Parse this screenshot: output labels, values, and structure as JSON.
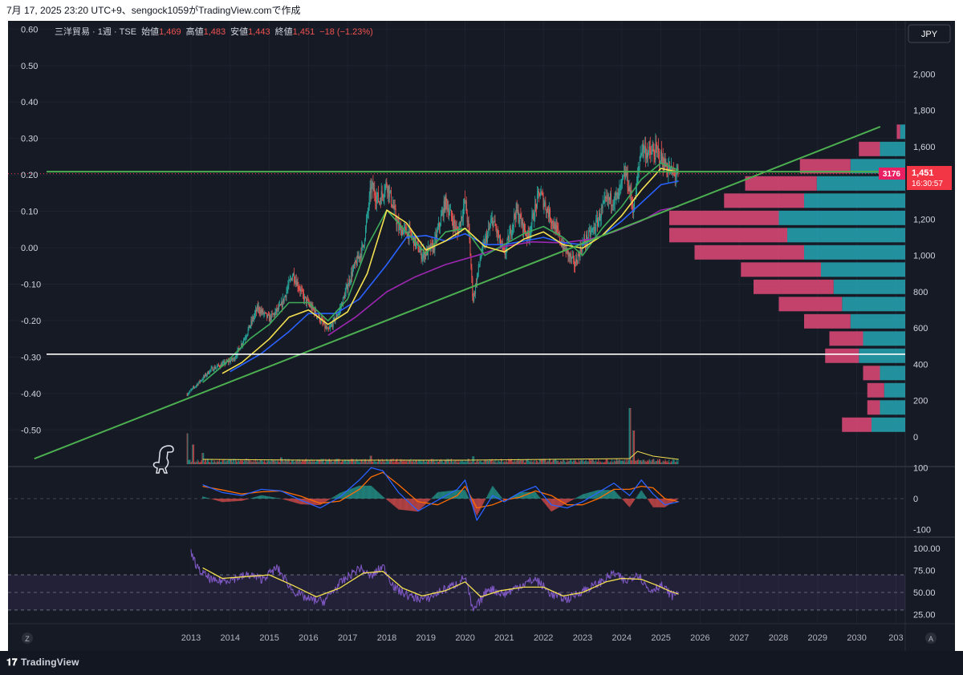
{
  "header": {
    "caption": "7月 17, 2025 23:20 UTC+9、sengock1059がTradingView.comで作成"
  },
  "legend": {
    "symbol": "三洋貿易 · 1週 · TSE",
    "open_label": "始値",
    "open": "1,469",
    "high_label": "高値",
    "high": "1,483",
    "low_label": "安値",
    "low": "1,443",
    "close_label": "終値",
    "close": "1,451",
    "change": "−18 (−1.23%)"
  },
  "currency": "JPY",
  "price_badge": {
    "value": "1,451",
    "countdown": "16:30:57"
  },
  "vp_badge": "3176",
  "pane_markers": {
    "left": "Z",
    "right": "A"
  },
  "footer": {
    "brand": "TradingView"
  },
  "colors": {
    "background": "#161a25",
    "up": "#26a69a",
    "down": "#ef5350",
    "ma_green": "#3dab5a",
    "ma_yellow": "#f5e150",
    "ma_blue": "#2962ff",
    "ma_purple": "#9c27b0",
    "trendline": "#4caf50",
    "resistance": "#4caf50",
    "support": "#ffffff",
    "vp_up": "#26a6b4",
    "vp_down": "#e04a78",
    "macd": "#2962ff",
    "signal": "#ff6d00",
    "rsi": "#7e57c2",
    "rsi_ma": "#f5e150"
  },
  "chart_data": [
    {
      "type": "candlestick",
      "pane": "price",
      "interval": "1W",
      "x_range": [
        2013,
        2030.6
      ],
      "y_range_right": [
        0,
        2150
      ],
      "y_range_left": [
        -0.6,
        0.62
      ],
      "right_ticks": [
        "0",
        "200",
        "400",
        "600",
        "800",
        "1,000",
        "1,200",
        "1,400",
        "1,600",
        "1,800",
        "2,000"
      ],
      "left_ticks": [
        "0.60",
        "0.50",
        "0.40",
        "0.30",
        "0.20",
        "0.10",
        "0.00",
        "-0.10",
        "-0.20",
        "-0.30",
        "-0.40",
        "-0.50"
      ],
      "x_ticks": [
        "2013",
        "2014",
        "2015",
        "2016",
        "2017",
        "2018",
        "2019",
        "2020",
        "2021",
        "2022",
        "2023",
        "2024",
        "2025",
        "2026",
        "2027",
        "2028",
        "2029",
        "2030",
        "203"
      ],
      "price_path": [
        [
          2012.9,
          235
        ],
        [
          2013.2,
          300
        ],
        [
          2013.5,
          370
        ],
        [
          2013.8,
          400
        ],
        [
          2014.1,
          430
        ],
        [
          2014.4,
          560
        ],
        [
          2014.7,
          710
        ],
        [
          2015.0,
          650
        ],
        [
          2015.3,
          720
        ],
        [
          2015.6,
          900
        ],
        [
          2015.9,
          760
        ],
        [
          2016.2,
          680
        ],
        [
          2016.5,
          580
        ],
        [
          2016.8,
          700
        ],
        [
          2017.1,
          900
        ],
        [
          2017.4,
          1050
        ],
        [
          2017.6,
          1380
        ],
        [
          2017.8,
          1300
        ],
        [
          2018.0,
          1400
        ],
        [
          2018.3,
          1150
        ],
        [
          2018.6,
          1120
        ],
        [
          2018.9,
          1000
        ],
        [
          2019.2,
          1050
        ],
        [
          2019.5,
          1300
        ],
        [
          2019.8,
          1120
        ],
        [
          2020.0,
          1300
        ],
        [
          2020.1,
          1120
        ],
        [
          2020.2,
          750
        ],
        [
          2020.4,
          1000
        ],
        [
          2020.7,
          1200
        ],
        [
          2021.0,
          1000
        ],
        [
          2021.3,
          1250
        ],
        [
          2021.6,
          1100
        ],
        [
          2021.9,
          1350
        ],
        [
          2022.2,
          1200
        ],
        [
          2022.5,
          1050
        ],
        [
          2022.8,
          950
        ],
        [
          2023.0,
          1060
        ],
        [
          2023.3,
          1150
        ],
        [
          2023.6,
          1300
        ],
        [
          2023.9,
          1320
        ],
        [
          2024.1,
          1460
        ],
        [
          2024.3,
          1250
        ],
        [
          2024.5,
          1600
        ],
        [
          2024.7,
          1560
        ],
        [
          2024.9,
          1570
        ],
        [
          2025.1,
          1500
        ],
        [
          2025.3,
          1450
        ],
        [
          2025.45,
          1451
        ]
      ],
      "ma_green": [
        [
          2013.3,
          300
        ],
        [
          2013.8,
          390
        ],
        [
          2014.5,
          540
        ],
        [
          2015.0,
          620
        ],
        [
          2015.5,
          740
        ],
        [
          2016.0,
          740
        ],
        [
          2016.5,
          640
        ],
        [
          2017.0,
          760
        ],
        [
          2017.5,
          1050
        ],
        [
          2018.0,
          1250
        ],
        [
          2018.5,
          1130
        ],
        [
          2019.0,
          1010
        ],
        [
          2019.5,
          1130
        ],
        [
          2020.0,
          1150
        ],
        [
          2020.5,
          1000
        ],
        [
          2021.0,
          1060
        ],
        [
          2021.5,
          1120
        ],
        [
          2022.0,
          1160
        ],
        [
          2022.5,
          1100
        ],
        [
          2023.0,
          1000
        ],
        [
          2023.5,
          1150
        ],
        [
          2024.0,
          1270
        ],
        [
          2024.5,
          1420
        ],
        [
          2025.0,
          1510
        ],
        [
          2025.45,
          1470
        ]
      ],
      "ma_yellow": [
        [
          2013.8,
          350
        ],
        [
          2014.3,
          410
        ],
        [
          2015.0,
          540
        ],
        [
          2015.5,
          660
        ],
        [
          2016.0,
          700
        ],
        [
          2016.5,
          620
        ],
        [
          2017.0,
          690
        ],
        [
          2017.5,
          900
        ],
        [
          2018.0,
          1250
        ],
        [
          2018.5,
          1180
        ],
        [
          2019.0,
          1030
        ],
        [
          2019.5,
          1080
        ],
        [
          2020.0,
          1150
        ],
        [
          2020.5,
          1050
        ],
        [
          2021.0,
          1020
        ],
        [
          2021.5,
          1090
        ],
        [
          2022.0,
          1130
        ],
        [
          2022.5,
          1060
        ],
        [
          2023.0,
          1040
        ],
        [
          2023.5,
          1110
        ],
        [
          2024.0,
          1220
        ],
        [
          2024.5,
          1360
        ],
        [
          2025.0,
          1480
        ],
        [
          2025.45,
          1460
        ]
      ],
      "ma_blue": [
        [
          2014.0,
          360
        ],
        [
          2014.8,
          460
        ],
        [
          2015.5,
          580
        ],
        [
          2016.0,
          680
        ],
        [
          2016.7,
          680
        ],
        [
          2017.3,
          760
        ],
        [
          2018.0,
          950
        ],
        [
          2018.5,
          1100
        ],
        [
          2019.0,
          1110
        ],
        [
          2019.5,
          1080
        ],
        [
          2020.0,
          1120
        ],
        [
          2020.5,
          1060
        ],
        [
          2021.0,
          1060
        ],
        [
          2021.5,
          1080
        ],
        [
          2022.0,
          1100
        ],
        [
          2022.5,
          1070
        ],
        [
          2023.0,
          1060
        ],
        [
          2023.5,
          1110
        ],
        [
          2024.0,
          1190
        ],
        [
          2024.5,
          1290
        ],
        [
          2025.0,
          1390
        ],
        [
          2025.45,
          1410
        ]
      ],
      "ma_purple": [
        [
          2016.5,
          560
        ],
        [
          2017.2,
          660
        ],
        [
          2018.0,
          800
        ],
        [
          2018.7,
          880
        ],
        [
          2019.5,
          950
        ],
        [
          2020.3,
          1000
        ],
        [
          2021.0,
          1050
        ],
        [
          2021.7,
          1075
        ],
        [
          2022.5,
          1070
        ],
        [
          2023.2,
          1090
        ],
        [
          2023.8,
          1130
        ],
        [
          2024.5,
          1190
        ],
        [
          2025.0,
          1250
        ],
        [
          2025.45,
          1270
        ]
      ],
      "trendline": [
        [
          2009.0,
          -120
        ],
        [
          2030.6,
          1710
        ]
      ],
      "resistance_level": 1462,
      "support_level": 456,
      "volume_profile": [
        {
          "price": 1680,
          "up": 0.06,
          "down": 0.04
        },
        {
          "price": 1585,
          "up": 0.3,
          "down": 0.25
        },
        {
          "price": 1490,
          "up": 0.65,
          "down": 0.6
        },
        {
          "price": 1395,
          "up": 1.05,
          "down": 0.85
        },
        {
          "price": 1300,
          "up": 1.2,
          "down": 0.95
        },
        {
          "price": 1205,
          "up": 1.5,
          "down": 1.3
        },
        {
          "price": 1110,
          "up": 1.4,
          "down": 1.4
        },
        {
          "price": 1015,
          "up": 1.2,
          "down": 1.3
        },
        {
          "price": 920,
          "up": 1.0,
          "down": 0.95
        },
        {
          "price": 825,
          "up": 0.85,
          "down": 0.95
        },
        {
          "price": 730,
          "up": 0.75,
          "down": 0.75
        },
        {
          "price": 635,
          "up": 0.65,
          "down": 0.55
        },
        {
          "price": 540,
          "up": 0.5,
          "down": 0.4
        },
        {
          "price": 445,
          "up": 0.55,
          "down": 0.4
        },
        {
          "price": 350,
          "up": 0.3,
          "down": 0.2
        },
        {
          "price": 255,
          "up": 0.25,
          "down": 0.2
        },
        {
          "price": 160,
          "up": 0.3,
          "down": 0.15
        },
        {
          "price": 65,
          "up": 0.4,
          "down": 0.35
        }
      ]
    },
    {
      "type": "bar",
      "pane": "volume",
      "spikes": [
        [
          2012.9,
          0.55
        ],
        [
          2013.05,
          0.35
        ],
        [
          2013.3,
          0.2
        ],
        [
          2015.3,
          0.12
        ],
        [
          2017.6,
          0.15
        ],
        [
          2020.2,
          0.14
        ],
        [
          2024.2,
          1.0
        ],
        [
          2024.3,
          0.6
        ]
      ]
    },
    {
      "type": "line",
      "pane": "macd",
      "y_range": [
        -110,
        110
      ],
      "y_ticks": [
        "100",
        "0",
        "-100"
      ],
      "macd": [
        [
          2013.3,
          45
        ],
        [
          2013.8,
          20
        ],
        [
          2014.3,
          10
        ],
        [
          2014.8,
          30
        ],
        [
          2015.3,
          25
        ],
        [
          2015.8,
          -5
        ],
        [
          2016.3,
          -30
        ],
        [
          2016.8,
          5
        ],
        [
          2017.3,
          60
        ],
        [
          2017.6,
          100
        ],
        [
          2017.9,
          90
        ],
        [
          2018.3,
          20
        ],
        [
          2018.8,
          -40
        ],
        [
          2019.3,
          -5
        ],
        [
          2019.8,
          30
        ],
        [
          2020.0,
          60
        ],
        [
          2020.3,
          -70
        ],
        [
          2020.7,
          10
        ],
        [
          2021.0,
          -10
        ],
        [
          2021.4,
          20
        ],
        [
          2021.8,
          40
        ],
        [
          2022.2,
          -20
        ],
        [
          2022.6,
          -30
        ],
        [
          2023.0,
          -10
        ],
        [
          2023.4,
          20
        ],
        [
          2023.8,
          50
        ],
        [
          2024.2,
          10
        ],
        [
          2024.5,
          60
        ],
        [
          2024.8,
          15
        ],
        [
          2025.1,
          -20
        ],
        [
          2025.45,
          -10
        ]
      ],
      "signal": [
        [
          2013.3,
          40
        ],
        [
          2013.8,
          28
        ],
        [
          2014.3,
          15
        ],
        [
          2014.8,
          22
        ],
        [
          2015.3,
          25
        ],
        [
          2015.8,
          8
        ],
        [
          2016.3,
          -15
        ],
        [
          2016.8,
          -8
        ],
        [
          2017.3,
          30
        ],
        [
          2017.6,
          70
        ],
        [
          2017.9,
          85
        ],
        [
          2018.3,
          45
        ],
        [
          2018.8,
          -10
        ],
        [
          2019.3,
          -20
        ],
        [
          2019.8,
          10
        ],
        [
          2020.0,
          40
        ],
        [
          2020.3,
          -30
        ],
        [
          2020.7,
          -20
        ],
        [
          2021.0,
          -5
        ],
        [
          2021.4,
          5
        ],
        [
          2021.8,
          25
        ],
        [
          2022.2,
          10
        ],
        [
          2022.6,
          -20
        ],
        [
          2023.0,
          -20
        ],
        [
          2023.4,
          0
        ],
        [
          2023.8,
          30
        ],
        [
          2024.2,
          30
        ],
        [
          2024.5,
          40
        ],
        [
          2024.8,
          35
        ],
        [
          2025.1,
          0
        ],
        [
          2025.45,
          -10
        ]
      ]
    },
    {
      "type": "line",
      "pane": "rsi",
      "y_range": [
        20,
        100
      ],
      "y_ticks": [
        "100.00",
        "75.00",
        "50.00",
        "25.00"
      ],
      "bands": [
        30,
        50,
        70
      ],
      "rsi": [
        [
          2013.0,
          95
        ],
        [
          2013.2,
          75
        ],
        [
          2013.6,
          62
        ],
        [
          2014.0,
          65
        ],
        [
          2014.5,
          70
        ],
        [
          2014.8,
          65
        ],
        [
          2015.2,
          78
        ],
        [
          2015.6,
          52
        ],
        [
          2016.0,
          42
        ],
        [
          2016.4,
          40
        ],
        [
          2016.8,
          60
        ],
        [
          2017.3,
          78
        ],
        [
          2017.6,
          68
        ],
        [
          2017.9,
          80
        ],
        [
          2018.2,
          55
        ],
        [
          2018.6,
          45
        ],
        [
          2019.0,
          42
        ],
        [
          2019.4,
          52
        ],
        [
          2019.8,
          60
        ],
        [
          2020.0,
          68
        ],
        [
          2020.2,
          28
        ],
        [
          2020.6,
          55
        ],
        [
          2021.0,
          48
        ],
        [
          2021.4,
          58
        ],
        [
          2021.8,
          65
        ],
        [
          2022.2,
          48
        ],
        [
          2022.6,
          42
        ],
        [
          2023.0,
          52
        ],
        [
          2023.4,
          60
        ],
        [
          2023.8,
          72
        ],
        [
          2024.1,
          62
        ],
        [
          2024.4,
          72
        ],
        [
          2024.7,
          52
        ],
        [
          2025.0,
          58
        ],
        [
          2025.3,
          46
        ],
        [
          2025.45,
          52
        ]
      ],
      "rsi_ma": [
        [
          2013.3,
          78
        ],
        [
          2013.8,
          66
        ],
        [
          2014.4,
          68
        ],
        [
          2015.0,
          70
        ],
        [
          2015.6,
          58
        ],
        [
          2016.2,
          45
        ],
        [
          2016.8,
          55
        ],
        [
          2017.4,
          72
        ],
        [
          2017.9,
          74
        ],
        [
          2018.4,
          55
        ],
        [
          2018.9,
          46
        ],
        [
          2019.5,
          52
        ],
        [
          2020.0,
          62
        ],
        [
          2020.4,
          45
        ],
        [
          2020.9,
          52
        ],
        [
          2021.5,
          56
        ],
        [
          2022.0,
          56
        ],
        [
          2022.5,
          46
        ],
        [
          2023.0,
          50
        ],
        [
          2023.6,
          62
        ],
        [
          2024.0,
          66
        ],
        [
          2024.5,
          65
        ],
        [
          2024.9,
          58
        ],
        [
          2025.2,
          52
        ],
        [
          2025.45,
          48
        ]
      ]
    }
  ]
}
